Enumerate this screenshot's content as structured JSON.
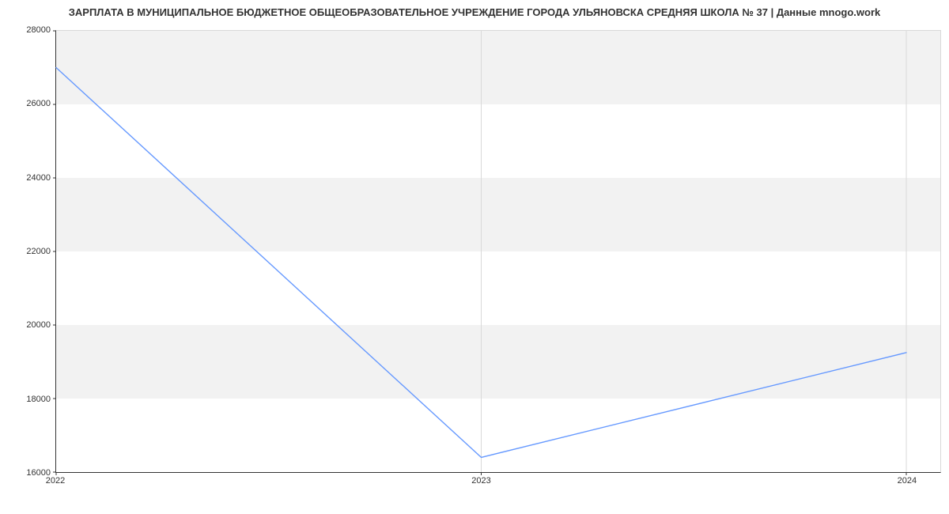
{
  "chart_data": {
    "type": "line",
    "title": "ЗАРПЛАТА В МУНИЦИПАЛЬНОЕ БЮДЖЕТНОЕ ОБЩЕОБРАЗОВАТЕЛЬНОЕ УЧРЕЖДЕНИЕ ГОРОДА УЛЬЯНОВСКА СРЕДНЯЯ ШКОЛА № 37 | Данные mnogo.work",
    "x": [
      2022,
      2023,
      2024
    ],
    "values": [
      27000,
      16400,
      19250
    ],
    "x_ticks": [
      2022,
      2023,
      2024
    ],
    "y_ticks": [
      16000,
      18000,
      20000,
      22000,
      24000,
      26000,
      28000
    ],
    "xlim": [
      2022,
      2024.08
    ],
    "ylim": [
      16000,
      28000
    ],
    "line_color": "#6699ff",
    "band_color": "#f2f2f2"
  }
}
